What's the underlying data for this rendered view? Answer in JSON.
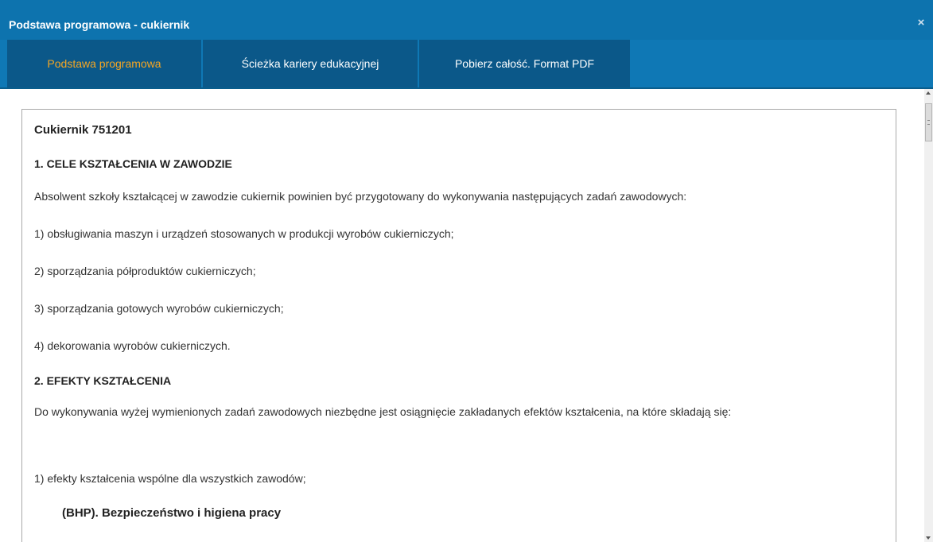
{
  "window": {
    "title": "Podstawa programowa - cukiernik",
    "close_glyph": "×"
  },
  "tabs": [
    {
      "label": "Podstawa programowa",
      "active": true
    },
    {
      "label": "Ścieżka kariery edukacyjnej",
      "active": false
    },
    {
      "label": "Pobierz całość. Format PDF",
      "active": false
    }
  ],
  "document": {
    "title": "Cukiernik 751201",
    "section1_heading": "1. CELE KSZTAŁCENIA W ZAWODZIE",
    "section1_intro": "Absolwent szkoły kształcącej w zawodzie cukiernik powinien być przygotowany do wykonywania następujących zadań zawodowych:",
    "section1_items": [
      "1) obsługiwania maszyn i urządzeń stosowanych w produkcji wyrobów cukierniczych;",
      "2) sporządzania półproduktów cukierniczych;",
      "3) sporządzania gotowych wyrobów cukierniczych;",
      "4) dekorowania wyrobów cukierniczych."
    ],
    "section2_heading": "2. EFEKTY KSZTAŁCENIA",
    "section2_intro": "Do wykonywania wyżej wymienionych zadań zawodowych niezbędne jest osiągnięcie zakładanych efektów kształcenia, na które składają się:",
    "section2_items": [
      "1) efekty kształcenia wspólne dla wszystkich zawodów;"
    ],
    "subheading": "(BHP). Bezpieczeństwo i higiena pracy"
  },
  "colors": {
    "header_bg": "#0d73ae",
    "tab_bg": "#0b5889",
    "active_tab_text": "#f5a623"
  }
}
